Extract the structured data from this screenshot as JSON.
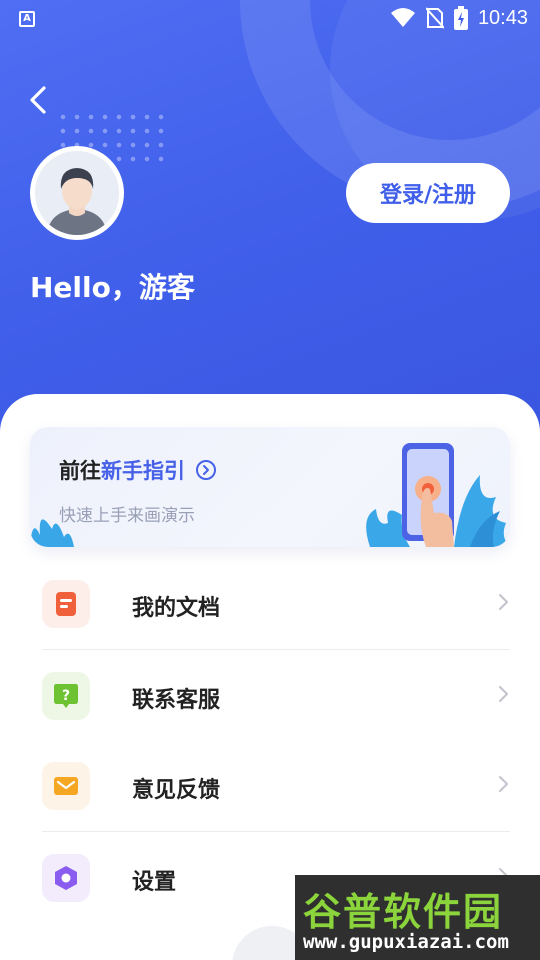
{
  "status_bar": {
    "app_icon_letter": "A",
    "time": "10:43",
    "icons": [
      "wifi-icon",
      "no-sim-icon",
      "battery-charging-icon"
    ]
  },
  "header": {
    "back_icon": "chevron-left-icon",
    "login_label": "登录/注册",
    "greeting": "Hello，游客"
  },
  "guide_card": {
    "title_prefix": "前往",
    "title_highlight": "新手指引",
    "subtitle": "快速上手来画演示",
    "go_icon": "circle-arrow-right-icon",
    "accent_color": "#4661e8"
  },
  "menu": [
    {
      "label": "我的文档",
      "icon": "document-icon",
      "color": "#f0603a"
    },
    {
      "label": "联系客服",
      "icon": "help-bubble-icon",
      "color": "#6cc230"
    },
    {
      "label": "意见反馈",
      "icon": "mail-icon",
      "color": "#f5a623"
    },
    {
      "label": "设置",
      "icon": "settings-hexagon-icon",
      "color": "#8b5cf0"
    }
  ],
  "watermark": {
    "title": "谷普软件园",
    "url": "www.gupuxiazai.com"
  },
  "colors": {
    "primary": "#3f5ee9",
    "background": "#ffffff"
  }
}
